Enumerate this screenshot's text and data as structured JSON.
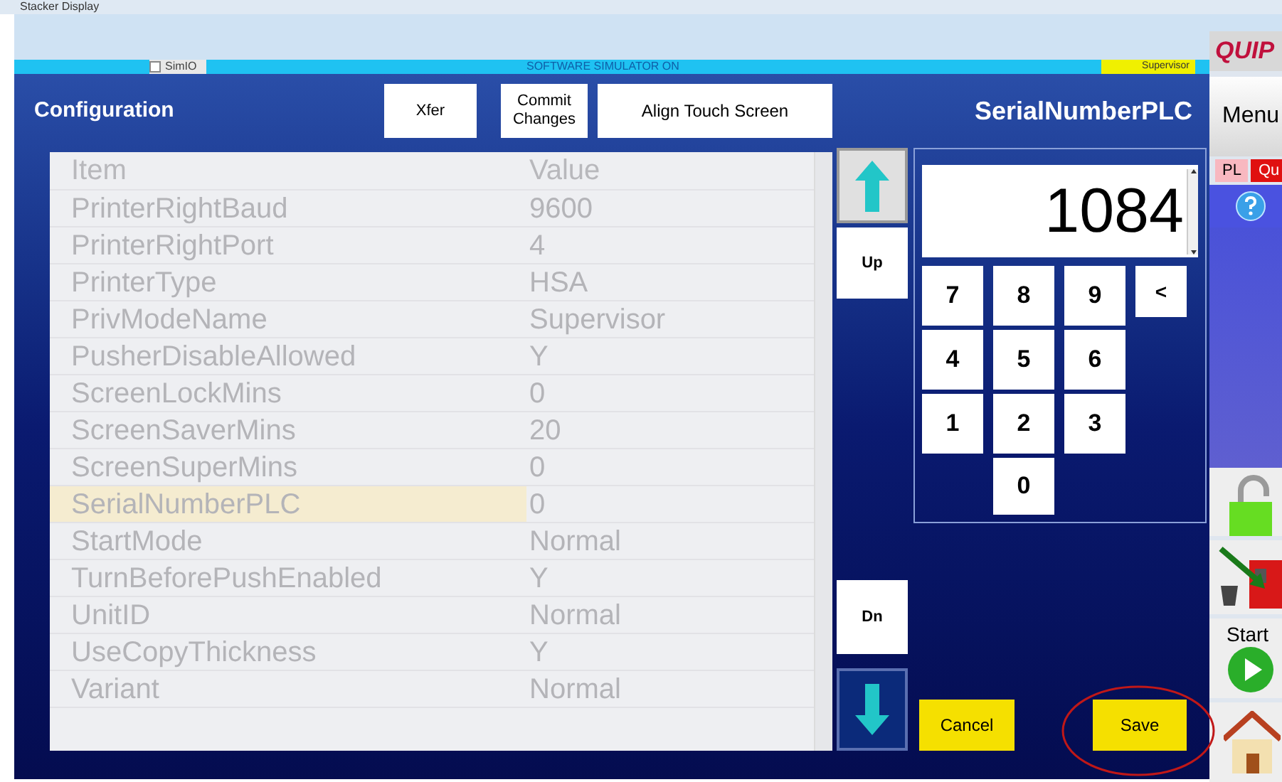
{
  "window": {
    "title": "Stacker Display"
  },
  "status_strip": {
    "simio": {
      "label": "SimIO",
      "checked": false
    },
    "message": "SOFTWARE SIMULATOR ON",
    "mode": "Supervisor"
  },
  "header": {
    "title": "Configuration",
    "buttons": [
      "Xfer",
      "Commit Changes",
      "Align Touch Screen"
    ],
    "field_name": "SerialNumberPLC"
  },
  "table": {
    "columns": [
      "Item",
      "Value"
    ],
    "rows": [
      {
        "item": "PrinterRightBaud",
        "value": "9600",
        "selected": false
      },
      {
        "item": "PrinterRightPort",
        "value": "4",
        "selected": false
      },
      {
        "item": "PrinterType",
        "value": "HSA",
        "selected": false
      },
      {
        "item": "PrivModeName",
        "value": "Supervisor",
        "selected": false
      },
      {
        "item": "PusherDisableAllowed",
        "value": "Y",
        "selected": false
      },
      {
        "item": "ScreenLockMins",
        "value": "0",
        "selected": false
      },
      {
        "item": "ScreenSaverMins",
        "value": "20",
        "selected": false
      },
      {
        "item": "ScreenSuperMins",
        "value": "0",
        "selected": false
      },
      {
        "item": "SerialNumberPLC",
        "value": "0",
        "selected": true
      },
      {
        "item": "StartMode",
        "value": "Normal",
        "selected": false
      },
      {
        "item": "TurnBeforePushEnabled",
        "value": "Y",
        "selected": false
      },
      {
        "item": "UnitID",
        "value": "Normal",
        "selected": false
      },
      {
        "item": "UseCopyThickness",
        "value": "Y",
        "selected": false
      },
      {
        "item": "Variant",
        "value": "Normal",
        "selected": false
      }
    ]
  },
  "nav": {
    "up": "Up",
    "down": "Dn"
  },
  "keypad": {
    "value": "1084",
    "keys": [
      "7",
      "8",
      "9",
      "<",
      "4",
      "5",
      "6",
      "1",
      "2",
      "3",
      "0"
    ]
  },
  "actions": [
    "Cancel",
    "Save"
  ],
  "sidebar": {
    "logo": "QUIP",
    "menu": "Menu",
    "tabs": [
      {
        "label": "PL",
        "selected": false
      },
      {
        "label": "Qu",
        "selected": true
      }
    ],
    "start": "Start"
  }
}
